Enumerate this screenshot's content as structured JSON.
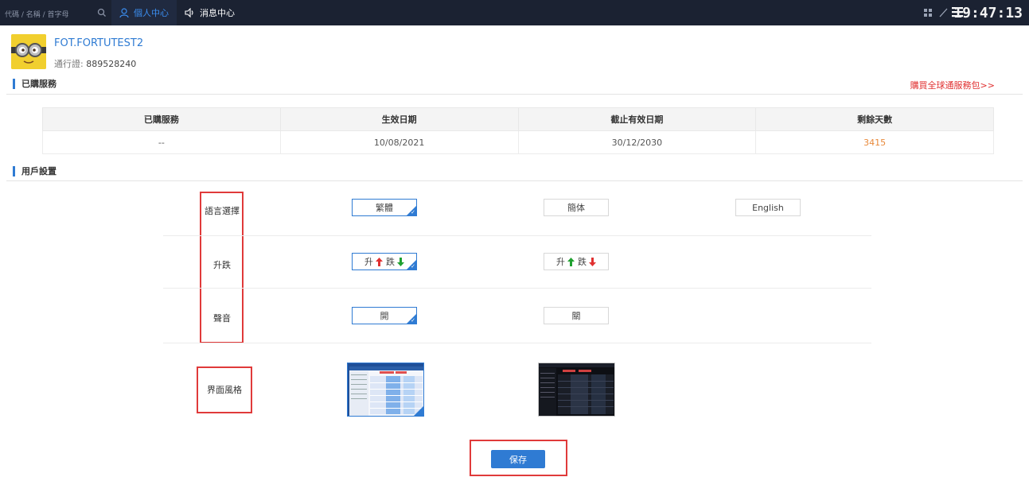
{
  "topbar": {
    "search_placeholder": "代碼 / 名稱 / 首字母",
    "tabs": [
      {
        "label": "個人中心",
        "active": true
      },
      {
        "label": "消息中心",
        "active": false
      }
    ],
    "clock": "19:47:13"
  },
  "profile": {
    "username": "FOT.FORTUTEST2",
    "pass_label": "通行證:",
    "pass_value": "889528240"
  },
  "services": {
    "title": "已購服務",
    "buy_link": "購買全球通服務包>>",
    "columns": [
      "已購服務",
      "生效日期",
      "截止有效日期",
      "剩餘天數"
    ],
    "rows": [
      [
        "--",
        "10/08/2021",
        "30/12/2030",
        "3415"
      ]
    ]
  },
  "settings": {
    "title": "用戶設置",
    "language": {
      "label": "語言選擇",
      "options": [
        "繁體",
        "簡体",
        "English"
      ],
      "selected": 0
    },
    "updown": {
      "label": "升跌",
      "options": [
        {
          "up": "升",
          "down": "跌",
          "up_color": "#e03030",
          "down_color": "#1fa030"
        },
        {
          "up": "升",
          "down": "跌",
          "up_color": "#1fa030",
          "down_color": "#e03030"
        }
      ],
      "selected": 0
    },
    "sound": {
      "label": "聲音",
      "options": [
        "開",
        "關"
      ],
      "selected": 0
    },
    "theme": {
      "label": "界面風格",
      "options": [
        "light",
        "dark"
      ],
      "selected": 0
    }
  },
  "save_label": "保存",
  "colors": {
    "accent": "#2f7bd3",
    "highlight_box": "#e03a3a",
    "days": "#e8893a",
    "topbar": "#1b2232"
  }
}
